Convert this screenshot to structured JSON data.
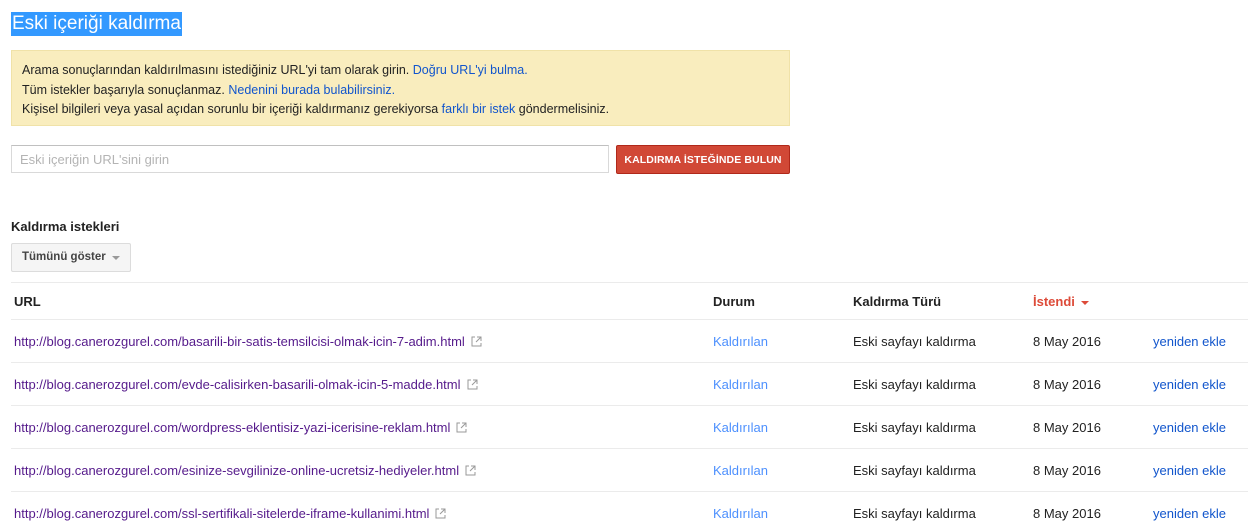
{
  "page": {
    "title": "Eski içeriği kaldırma"
  },
  "notice": {
    "line1_text": "Arama sonuçlarından kaldırılmasını istediğiniz URL'yi tam olarak girin.",
    "line1_link": "Doğru URL'yi bulma.",
    "line2_text": "Tüm istekler başarıyla sonuçlanmaz.",
    "line2_link": "Nedenini burada bulabilirsiniz.",
    "line3_text_before": "Kişisel bilgileri veya yasal açıdan sorunlu bir içeriği kaldırmanız gerekiyorsa",
    "line3_link": "farklı bir istek",
    "line3_text_after": "göndermelisiniz."
  },
  "search": {
    "value": "",
    "placeholder": "Eski içeriğin URL'sini girin",
    "button_label": "KALDIRMA İSTEĞİNDE BULUN"
  },
  "requests": {
    "section_title": "Kaldırma istekleri",
    "filter_label": "Tümünü göster",
    "columns": {
      "url": "URL",
      "status": "Durum",
      "type": "Kaldırma Türü",
      "date": "İstendi"
    },
    "rows": [
      {
        "url": "http://blog.canerozgurel.com/basarili-bir-satis-temsilcisi-olmak-icin-7-adim.html",
        "status": "Kaldırılan",
        "type": "Eski sayfayı kaldırma",
        "date": "8 May 2016",
        "action": "yeniden ekle"
      },
      {
        "url": "http://blog.canerozgurel.com/evde-calisirken-basarili-olmak-icin-5-madde.html",
        "status": "Kaldırılan",
        "type": "Eski sayfayı kaldırma",
        "date": "8 May 2016",
        "action": "yeniden ekle"
      },
      {
        "url": "http://blog.canerozgurel.com/wordpress-eklentisiz-yazi-icerisine-reklam.html",
        "status": "Kaldırılan",
        "type": "Eski sayfayı kaldırma",
        "date": "8 May 2016",
        "action": "yeniden ekle"
      },
      {
        "url": "http://blog.canerozgurel.com/esinize-sevgilinize-online-ucretsiz-hediyeler.html",
        "status": "Kaldırılan",
        "type": "Eski sayfayı kaldırma",
        "date": "8 May 2016",
        "action": "yeniden ekle"
      },
      {
        "url": "http://blog.canerozgurel.com/ssl-sertifikali-sitelerde-iframe-kullanimi.html",
        "status": "Kaldırılan",
        "type": "Eski sayfayı kaldırma",
        "date": "8 May 2016",
        "action": "yeniden ekle"
      }
    ]
  },
  "colors": {
    "accent_red": "#d14836",
    "link_blue": "#1155cc",
    "visited_purple": "#551a8b",
    "notice_bg": "#f9edbe",
    "selection_blue": "#3399ff"
  }
}
